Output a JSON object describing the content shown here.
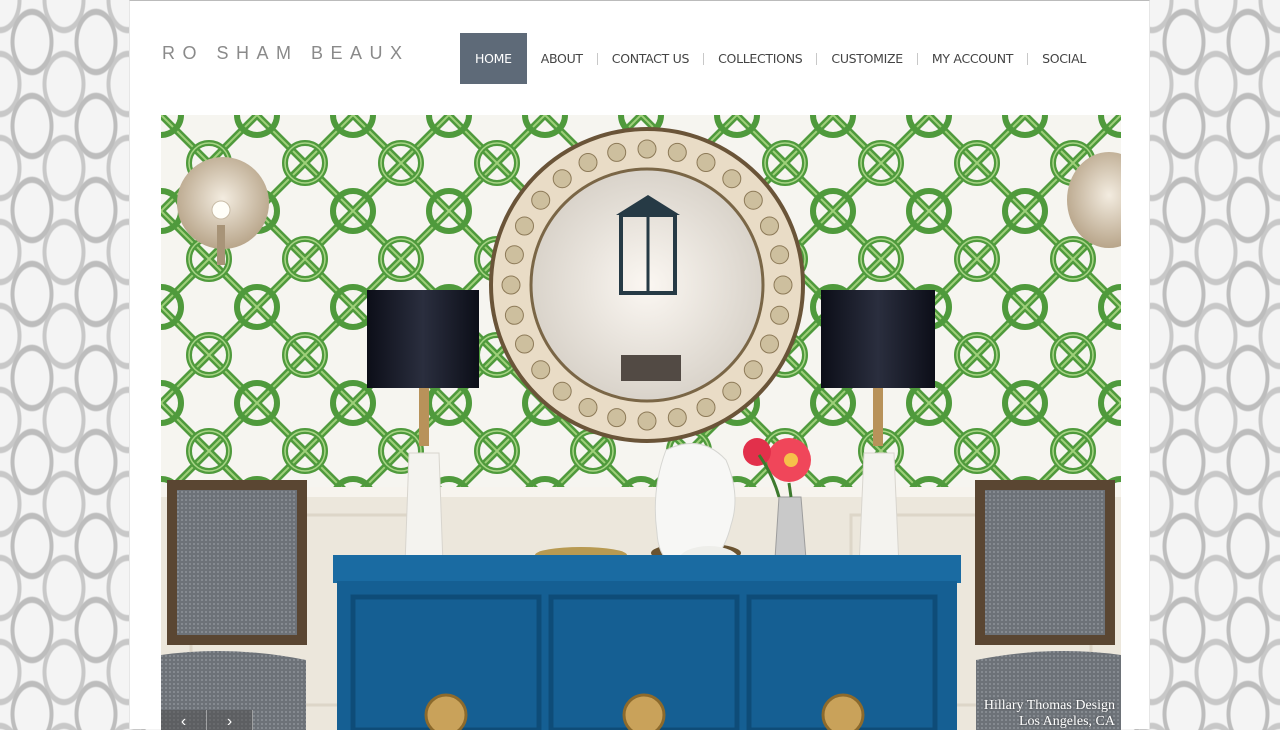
{
  "brand": {
    "name": "RO SHAM BEAUX"
  },
  "nav": {
    "items": [
      {
        "label": "HOME",
        "active": true
      },
      {
        "label": "ABOUT",
        "active": false
      },
      {
        "label": "CONTACT US",
        "active": false
      },
      {
        "label": "COLLECTIONS",
        "active": false
      },
      {
        "label": "CUSTOMIZE",
        "active": false
      },
      {
        "label": "MY ACCOUNT",
        "active": false
      },
      {
        "label": "SOCIAL",
        "active": false
      }
    ],
    "active_color": "#5e6a78"
  },
  "hero": {
    "caption_line1": "Hillary Thomas Design",
    "caption_line2": "Los Angeles, CA",
    "prev_icon": "chevron-left-icon",
    "next_icon": "chevron-right-icon",
    "prev_glyph": "‹",
    "next_glyph": "›"
  },
  "colors": {
    "wallpaper_green": "#4f9a3c",
    "console_blue": "#155f93",
    "lampshade": "#1a1d2a",
    "brass": "#c9a25a"
  }
}
